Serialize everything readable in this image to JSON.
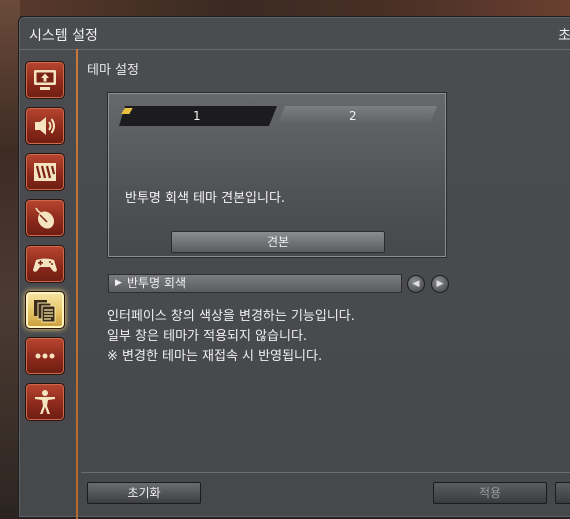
{
  "window": {
    "title": "시스템 설정",
    "close_label": "초"
  },
  "sidebar": {
    "items": [
      {
        "name": "display",
        "icon": "monitor-icon"
      },
      {
        "name": "sound",
        "icon": "speaker-icon"
      },
      {
        "name": "ui",
        "icon": "stripes-icon"
      },
      {
        "name": "mouse",
        "icon": "mouse-icon"
      },
      {
        "name": "gamepad",
        "icon": "gamepad-icon"
      },
      {
        "name": "theme",
        "icon": "documents-icon",
        "active": true
      },
      {
        "name": "other",
        "icon": "dots-icon"
      },
      {
        "name": "character",
        "icon": "person-icon"
      }
    ]
  },
  "section": {
    "title": "테마 설정"
  },
  "preview": {
    "tabs": [
      "1",
      "2"
    ],
    "sample_text": "반투명 회색 테마 견본입니다.",
    "sample_button": "견본"
  },
  "theme_select": {
    "value": "반투명 회색",
    "prev_icon": "chevron-left-icon",
    "next_icon": "chevron-right-icon"
  },
  "info": {
    "line1": "인터페이스 창의 색상을 변경하는 기능입니다.",
    "line2": "일부 창은 테마가 적용되지 않습니다.",
    "line3": "※ 변경한 테마는 재접속 시 반영됩니다."
  },
  "footer": {
    "reset_label": "초기화",
    "apply_label": "적용"
  },
  "colors": {
    "accent": "#c8783a",
    "sidebar_button": "#9a3322",
    "active_button": "#e8c86a"
  }
}
